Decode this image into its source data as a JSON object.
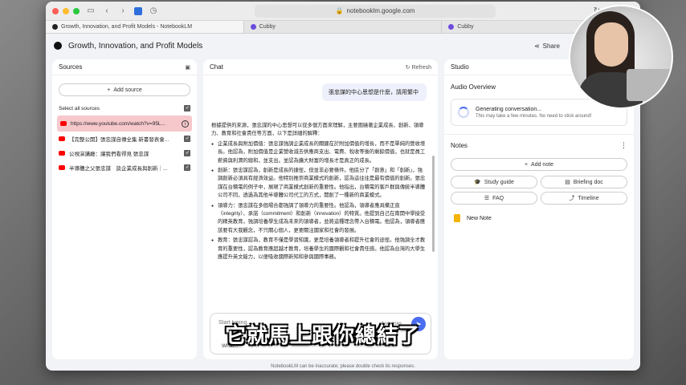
{
  "browser": {
    "url": "notebooklm.google.com",
    "tabs": [
      {
        "label": "Growth, Innovation, and Profit Models - NotebookLM",
        "active": true
      },
      {
        "label": "Cubby",
        "active": false
      },
      {
        "label": "Cubby",
        "active": false
      }
    ]
  },
  "app": {
    "title": "Growth, Innovation, and Profit Models",
    "share_label": "Share"
  },
  "sources": {
    "header": "Sources",
    "add_label": "Add source",
    "select_all": "Select all sources",
    "items": [
      {
        "label": "https://www.youtube.com/watch?v=95L..."
      },
      {
        "label": "【完整公開】張忠謀自傳全集 新書發表會..."
      },
      {
        "label": "公視演講廳：讓我們看得見 張忠謀"
      },
      {
        "label": "半導體之父張忠謀　談企業成長與創新｜..."
      }
    ]
  },
  "chat": {
    "header": "Chat",
    "refresh_label": "Refresh",
    "user_message": "張忠謀的中心思想是什麼，請用繁中",
    "answer": {
      "intro": "根據提供的來源，張忠謀的中心思想可以從多個方面來理解，主要圍繞著企業成長、創新、領導力、教育和社會責任等方面，以下是詳細的解釋：",
      "points": [
        "企業成長與附加價值：張忠謀強調企業成長的關鍵在於附加價值的增長，而不是單純的營收增長。他認為，附加價值是企業營收減去供應商支出、電費、稅收等後的剩餘價值，也就是員工薪資與利潤的總和，並支出。並認為擴大財富的增長才是真正的成長。",
        "創新：張忠謀認為，創新是成長的捷徑，但並非必要條件。他區分了「創意」和「創新」，強調創新必須具有經濟效益。他特別推崇商業模式的創新，認為這往往是最有價值的創新。張忠謀在台積電的例子中，展現了商業模式創新的重要性。他指出，台積電的客戶群與傳統半導體公司不同，透過為其他半導體公司代工的方式，開創了一種新的商業模式。",
        "領導力：張忠謀在多個場合都強調了領導力的重要性。他認為，領導者應具備正直（integrity）、承諾（commitment）和創新（innovation）的特質。他提到自己在南開中學接受的精英教育，強調培養學生成為未來的領導者，並將這種理念帶入台積電。他認為，領導者應該要有大我觀念，不只關心個人，更要關注國家和社會的發展。",
        "教育：張忠謀認為，教育不僅是學習知識，更是培養領導者和提升社會的途徑。他強調全才教育的重要性，認為教育應超越才教育，培養學生的國際觀和社會責任感。他認為台灣的大學生應提升英文能力，以便吸收國際新知和參與國際事務。"
      ]
    },
    "input_placeholder": "Start typing...",
    "source_count": "4 sources",
    "suggestion": "What...",
    "subtitle": "它就馬上跟你總結了",
    "disclaimer": "NotebookLM can be inaccurate; please double check its responses."
  },
  "studio": {
    "header": "Studio",
    "audio_title": "Audio Overview",
    "generating_title": "Generating conversation...",
    "generating_sub": "This may take a few minutes. No need to stick around!",
    "notes_header": "Notes",
    "add_note_label": "Add note",
    "note_buttons": [
      "Study guide",
      "Briefing doc",
      "FAQ",
      "Timeline"
    ],
    "new_note_label": "New Note"
  },
  "colors": {
    "accent": "#4a6cf0",
    "highlight_source": "#f6c8cc",
    "youtube": "#ff0000"
  }
}
